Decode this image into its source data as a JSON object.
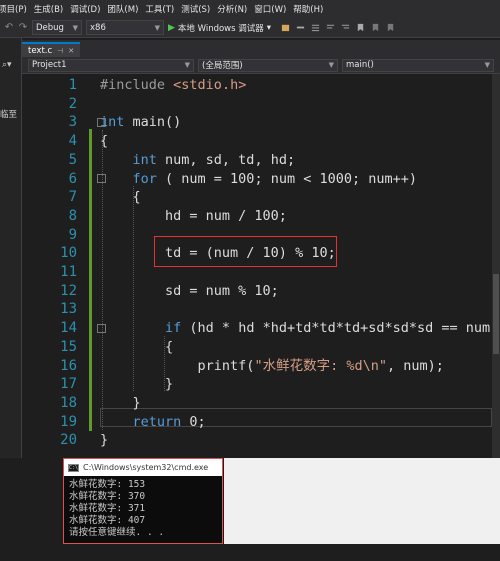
{
  "menu": [
    "项目(P)",
    "生成(B)",
    "调试(D)",
    "团队(M)",
    "工具(T)",
    "测试(S)",
    "分析(N)",
    "窗口(W)",
    "帮助(H)"
  ],
  "toolbar": {
    "config": "Debug",
    "platform": "x86",
    "run_label": "本地 Windows 调试器",
    "run_dropdown": "▾"
  },
  "left_panel": {
    "label": "临至"
  },
  "tab": {
    "filename": "text.c"
  },
  "navbar": {
    "project": "Project1",
    "scope": "(全局范围)",
    "function": "main()"
  },
  "code_lines": [
    {
      "n": "1",
      "html": "<span class='inc'>#include</span> <span class='incpath'>&lt;stdio.h&gt;</span>"
    },
    {
      "n": "2",
      "html": ""
    },
    {
      "n": "3",
      "html": "<span class='kw'>int</span> main()"
    },
    {
      "n": "4",
      "html": "{"
    },
    {
      "n": "5",
      "html": "    <span class='kw'>int</span> num, sd, td, hd;"
    },
    {
      "n": "6",
      "html": "    <span class='kw'>for</span> ( num = 100; num &lt; 1000; num++)"
    },
    {
      "n": "7",
      "html": "    {"
    },
    {
      "n": "8",
      "html": "        hd = num / 100;"
    },
    {
      "n": "9",
      "html": ""
    },
    {
      "n": "10",
      "html": "        td = (num / 10) % 10;"
    },
    {
      "n": "11",
      "html": ""
    },
    {
      "n": "12",
      "html": "        sd = num % 10;"
    },
    {
      "n": "13",
      "html": ""
    },
    {
      "n": "14",
      "html": "        <span class='kw'>if</span> (hd * hd *hd+td*td*td+sd*sd*sd == num)"
    },
    {
      "n": "15",
      "html": "        {"
    },
    {
      "n": "16",
      "html": "            printf(<span class='str'>\"水鲜花数字: %d\\n\"</span>, num);"
    },
    {
      "n": "17",
      "html": "        }"
    },
    {
      "n": "18",
      "html": "    }"
    },
    {
      "n": "19",
      "html": "    <span class='kw'>return</span> 0;"
    },
    {
      "n": "20",
      "html": "}"
    }
  ],
  "console": {
    "title": "C:\\Windows\\system32\\cmd.exe",
    "lines": [
      "水鲜花数字: 153",
      "水鲜花数字: 370",
      "水鲜花数字: 371",
      "水鲜花数字: 407",
      "请按任意键继续. . ."
    ]
  },
  "colors": {
    "keyword": "#569cd6",
    "string": "#d69d85",
    "line_number": "#2b91af",
    "highlight_box": "#e23333",
    "change_bar": "#5c9b2c"
  },
  "icons": [
    "undo-icon",
    "redo-icon",
    "play-icon",
    "bookmark-icon",
    "search-icon"
  ]
}
